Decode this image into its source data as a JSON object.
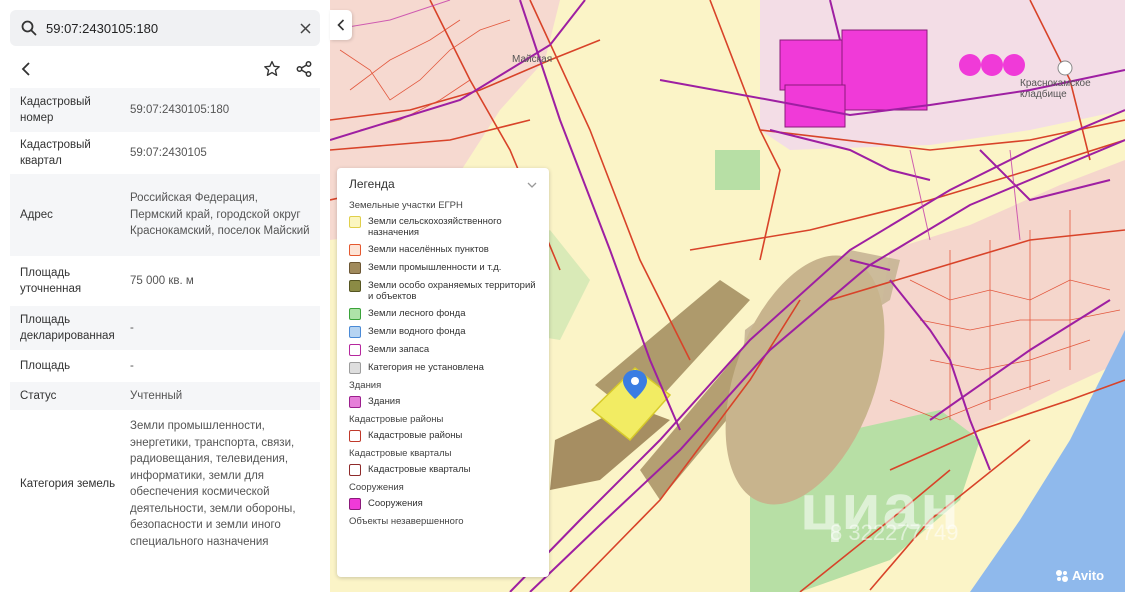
{
  "search": {
    "value": "59:07:2430105:180"
  },
  "properties": [
    {
      "key": "Кадастровый номер",
      "value": "59:07:2430105:180"
    },
    {
      "key": "Кадастровый квартал",
      "value": "59:07:2430105"
    },
    {
      "key": "Адрес",
      "value": "Российская Федерация, Пермский край, городской округ Краснокамский, поселок Майский"
    },
    {
      "key": "Площадь уточненная",
      "value": "75 000 кв. м"
    },
    {
      "key": "Площадь декларированная",
      "value": "-"
    },
    {
      "key": "Площадь",
      "value": "-"
    },
    {
      "key": "Статус",
      "value": "Учтенный"
    },
    {
      "key": "Категория земель",
      "value": "Земли промышленности, энергетики, транспорта, связи, радиовещания, телевидения, информатики, земли для обеспечения космической деятельности, земли обороны, безопасности и земли иного специального назначения"
    }
  ],
  "legend": {
    "title": "Легенда",
    "groups": [
      {
        "name": "Земельные участки ЕГРН",
        "items": [
          {
            "label": "Земли сельскохозяйственного назначения",
            "fill": "#fbf6c0",
            "stroke": "#e0cf4a"
          },
          {
            "label": "Земли населённых пунктов",
            "fill": "#fde4d6",
            "stroke": "#e4582f"
          },
          {
            "label": "Земли промышленности и т.д.",
            "fill": "#a08a5c",
            "stroke": "#6b5633"
          },
          {
            "label": "Земли особо охраняемых территорий и объектов",
            "fill": "#8b8b45",
            "stroke": "#555522"
          },
          {
            "label": "Земли лесного фонда",
            "fill": "#aee3a8",
            "stroke": "#3aa33a"
          },
          {
            "label": "Земли водного фонда",
            "fill": "#b6d4f2",
            "stroke": "#4a8ad6"
          },
          {
            "label": "Земли запаса",
            "fill": "#ffffff",
            "stroke": "#b5279e"
          },
          {
            "label": "Категория не установлена",
            "fill": "#dedede",
            "stroke": "#9c9c9c"
          }
        ]
      },
      {
        "name": "Здания",
        "items": [
          {
            "label": "Здания",
            "fill": "#e67fd9",
            "stroke": "#9b1f8d"
          }
        ]
      },
      {
        "name": "Кадастровые районы",
        "items": [
          {
            "label": "Кадастровые районы",
            "fill": "#ffffff",
            "stroke": "#c0392b"
          }
        ]
      },
      {
        "name": "Кадастровые кварталы",
        "items": [
          {
            "label": "Кадастровые кварталы",
            "fill": "#ffffff",
            "stroke": "#8e2a2a"
          }
        ]
      },
      {
        "name": "Сооружения",
        "items": [
          {
            "label": "Сооружения",
            "fill": "#f03ad8",
            "stroke": "#8a1a7a"
          }
        ]
      },
      {
        "name": "Объекты незавершенного",
        "items": []
      }
    ]
  },
  "map": {
    "labels": {
      "cemetery": "Краснокамское кладбище",
      "corner": "Майская",
      "watermark": "циан",
      "phone": "8 322277749",
      "brand": "Avito"
    }
  }
}
